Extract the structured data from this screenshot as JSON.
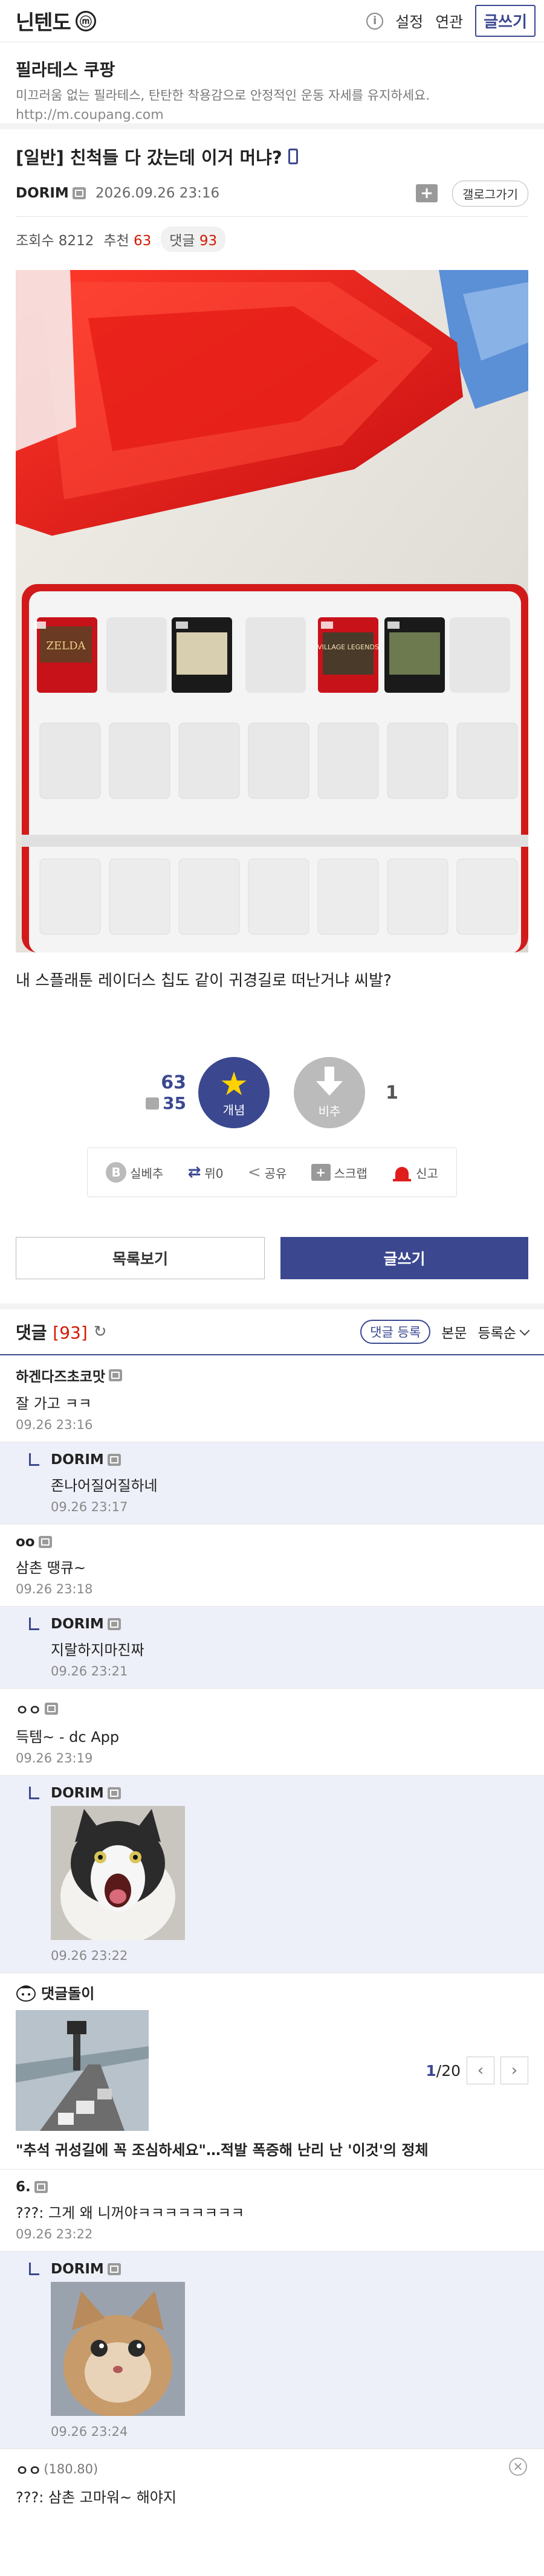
{
  "header": {
    "gallery_name": "닌텐도",
    "mini_badge": "ⓜ",
    "info_icon": "info-icon",
    "settings": "설정",
    "related": "연관",
    "write": "글쓰기"
  },
  "ad": {
    "title": "필라테스 쿠팡",
    "desc": "미끄러움 없는 필라테스, 탄탄한 착용감으로 안정적인 운동 자세를 유지하세요.",
    "url": "http://m.coupang.com"
  },
  "post": {
    "title": "[일반] 친척들 다 갔는데 이거 머냐?",
    "author": "DORIM",
    "date": "2026.09.26 23:16",
    "gallog": "갤로그가기",
    "views_label": "조회수",
    "views": "8212",
    "rec_label": "추천",
    "rec": "63",
    "cmt_label": "댓글",
    "cmt": "93",
    "body": "내 스플래툰 레이더스 칩도 같이 귀경길로 떠난거냐 씨발?",
    "game_cards": [
      "ZELDA",
      "",
      "VILLAGE LEGENDS",
      ""
    ]
  },
  "recommend": {
    "up_count": "63",
    "fix_count": "35",
    "up_label": "개념",
    "down_label": "비추",
    "down_count": "1"
  },
  "actions": {
    "silbest": "실베추",
    "retweet": "뮈0",
    "share": "공유",
    "scrap": "스크랩",
    "report": "신고"
  },
  "bottom": {
    "list": "목록보기",
    "write": "글쓰기"
  },
  "comments_header": {
    "title": "댓글",
    "count": "[93]",
    "register": "댓글 등록",
    "body": "본문",
    "sort": "등록순"
  },
  "comments": [
    {
      "nick": "하겐다즈초코맛",
      "ip": "",
      "text": "잘 가고 ㅋㅋ",
      "date": "09.26 23:16"
    },
    {
      "nick": "DORIM",
      "ip": "",
      "text": "존나어질어질하네",
      "date": "09.26 23:17"
    },
    {
      "nick": "oo",
      "ip": "",
      "text": "삼촌 땡큐~",
      "date": "09.26 23:18"
    },
    {
      "nick": "DORIM",
      "ip": "",
      "text": "지랄하지마진짜",
      "date": "09.26 23:21"
    },
    {
      "nick": "ㅇㅇ",
      "ip": "",
      "text": "득템~ - dc App",
      "date": "09.26 23:19"
    },
    {
      "nick": "DORIM",
      "ip": "",
      "text": "",
      "date": "09.26 23:22"
    },
    {
      "nick": "6.",
      "ip": "",
      "text": "???: 그게 왜 니꺼야ㅋㅋㅋㅋㅋㅋㅋㅋ",
      "date": "09.26 23:22"
    },
    {
      "nick": "DORIM",
      "ip": "",
      "text": "",
      "date": "09.26 23:24"
    },
    {
      "nick": "ㅇㅇ",
      "ip": "(180.80)",
      "text": "???: 삼촌 고마워~ 해야지",
      "date": ""
    }
  ],
  "dcbot": {
    "title": "댓글돌이",
    "page_current": "1",
    "page_total": "/20",
    "headline": "\"추석 귀성길에 꼭 조심하세요\"…적발 폭증해 난리 난 '이것'의 정체"
  }
}
